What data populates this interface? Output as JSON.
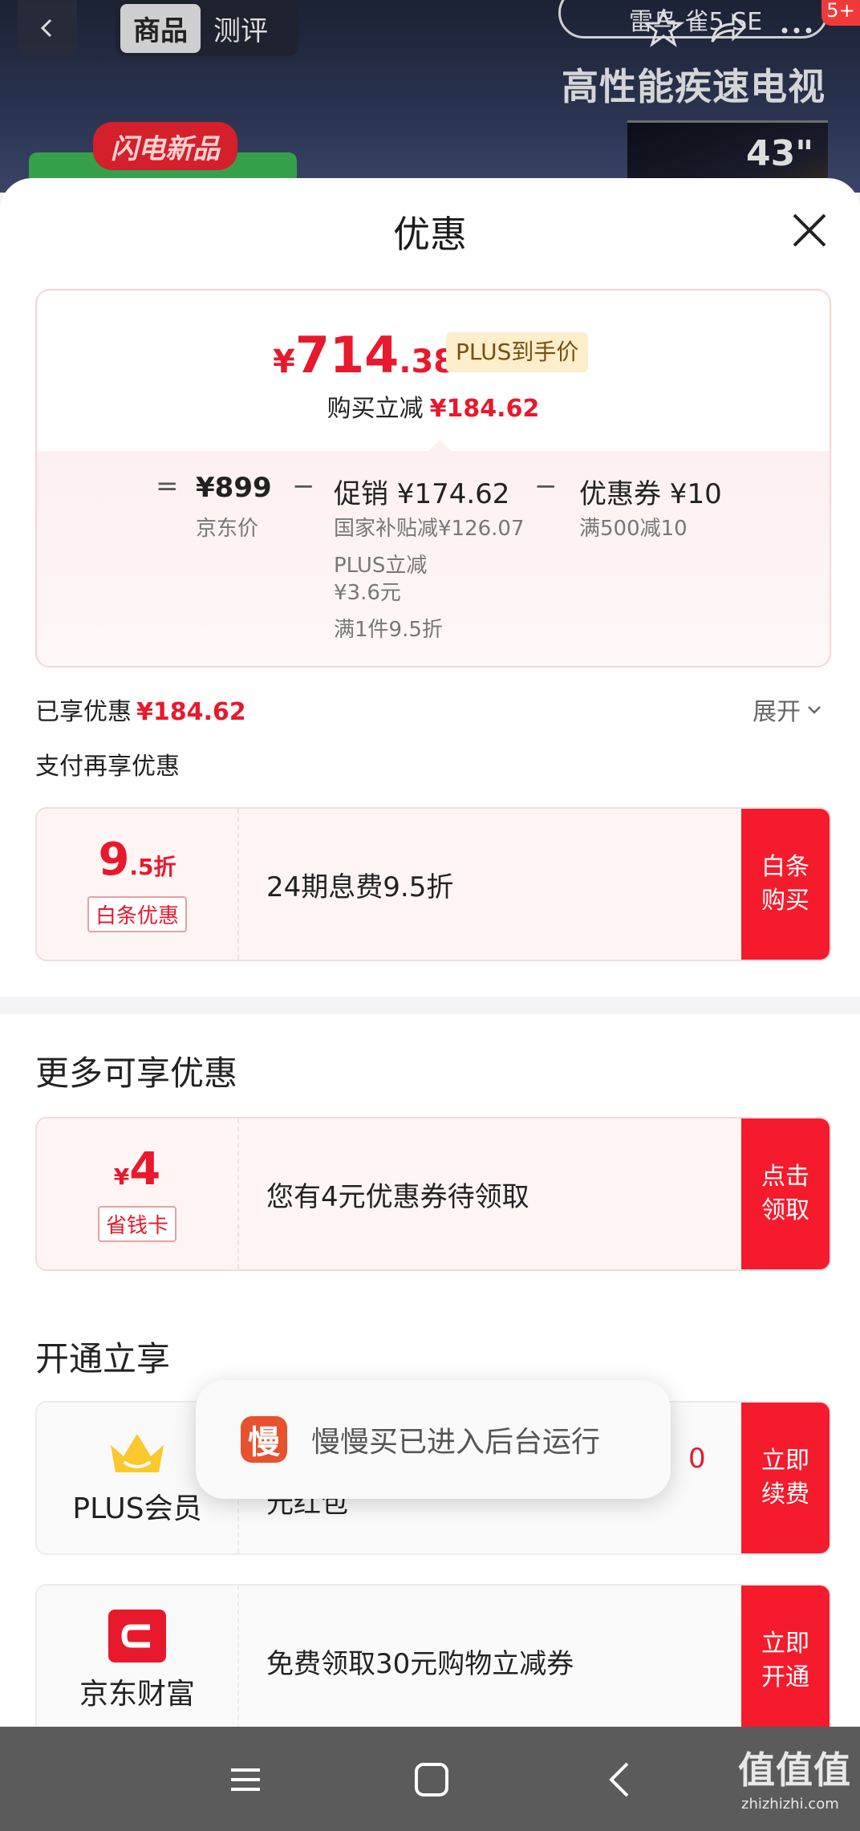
{
  "header": {
    "tabs": [
      {
        "label": "商品",
        "active": true
      },
      {
        "label": "测评",
        "active": false
      }
    ],
    "search_text": "雷鸟 雀5 SE",
    "badge": "5+",
    "hero_text": "高性能疾速电视",
    "new_badge": "闪电新品",
    "tv_size": "43\""
  },
  "sheet": {
    "title": "优惠",
    "price": {
      "currency": "¥",
      "integer": "714",
      "decimal": ".38",
      "tag": "PLUS到手价",
      "buy_save_label": "购买立减",
      "buy_save_value": "¥184.62"
    },
    "breakdown": {
      "eq": "=",
      "minus": "−",
      "jd_price": "¥899",
      "jd_price_label": "京东价",
      "promo_title": "促销 ¥174.62",
      "promo_items": [
        "国家补贴减¥126.07",
        "PLUS立减",
        "¥3.6元",
        "满1件9.5折"
      ],
      "coupon_title": "优惠券 ¥10",
      "coupon_sub": "满500减10"
    },
    "savings_label": "已享优惠",
    "savings_value": "¥184.62",
    "expand_label": "展开",
    "pay_title": "支付再享优惠",
    "baitiao": {
      "discount_main": "9",
      "discount_suffix": ".5折",
      "tag": "白条优惠",
      "desc": "24期息费9.5折",
      "cta": "白条\n购买"
    },
    "more_title": "更多可享优惠",
    "coupon_card": {
      "currency": "¥",
      "amount": "4",
      "tag": "省钱卡",
      "desc": "您有4元优惠券待领取",
      "cta": "点击\n领取"
    },
    "open_title": "开通立享",
    "plus_card": {
      "label": "PLUS会员",
      "desc_tail": "元红包",
      "desc_red": "0",
      "cta": "立即\n续费"
    },
    "jd_finance_card": {
      "label": "京东财富",
      "desc": "免费领取30元购物立减券",
      "cta": "立即\n开通"
    }
  },
  "toast": {
    "icon_char": "慢",
    "text": "慢慢买已进入后台运行"
  },
  "watermark": {
    "main": "值值值",
    "sub": "zhizhizhi.com"
  },
  "colors": {
    "accent_red": "#e8192c",
    "cta_red": "#f51b2c",
    "plus_gold": "#fdeecc"
  }
}
